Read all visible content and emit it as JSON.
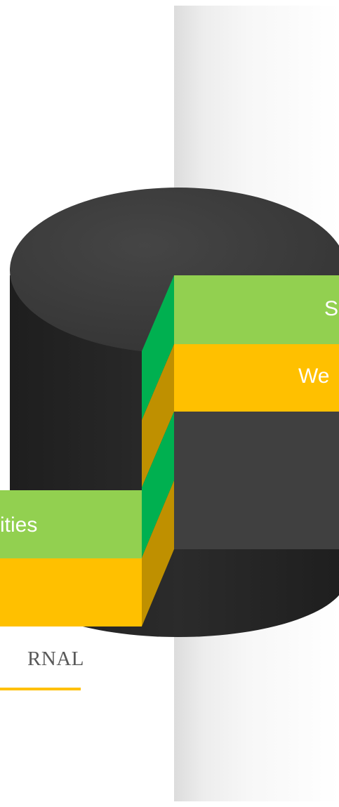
{
  "diagram": {
    "colors": {
      "cylinder_top": "#3a3a3a",
      "cylinder_body": "#262626",
      "cut_face": "#404040",
      "green": "#92d050",
      "green_side": "#00b050",
      "gold": "#ffc000",
      "gold_side": "#bf9000"
    },
    "labels": {
      "strengths_partial": "S",
      "weaknesses_partial": "We",
      "opportunities_partial": "ities"
    },
    "caption": "RNAL"
  }
}
